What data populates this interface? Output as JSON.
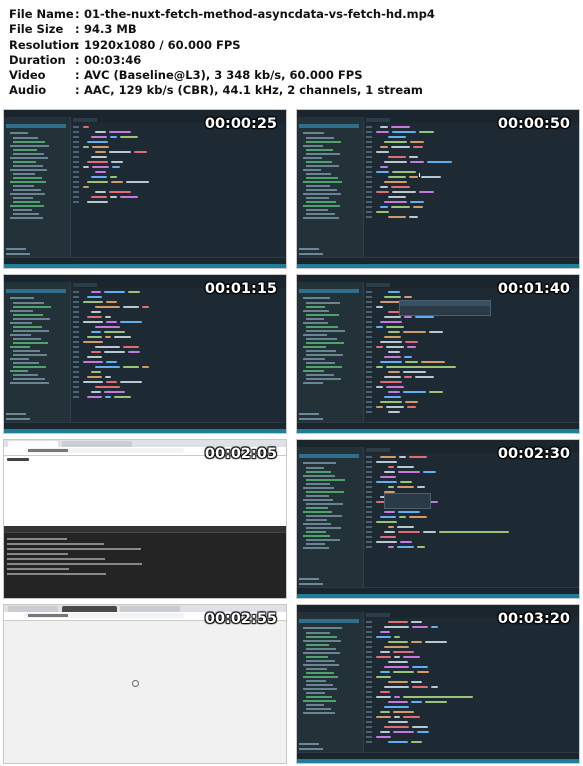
{
  "info": {
    "rows": [
      {
        "key": "File Name",
        "value": "01-the-nuxt-fetch-method-asyncdata-vs-fetch-hd.mp4"
      },
      {
        "key": "File Size",
        "value": "94.3 MB"
      },
      {
        "key": "Resolution",
        "value": "1920x1080 / 60.000 FPS"
      },
      {
        "key": "Duration",
        "value": "00:03:46"
      },
      {
        "key": "Video",
        "value": "AVC (Baseline@L3), 3 348 kb/s, 60.000 FPS"
      },
      {
        "key": "Audio",
        "value": "AAC, 129 kb/s (CBR), 44.1 kHz, 2 channels, 1 stream"
      }
    ],
    "separator": ":"
  },
  "thumbnails": [
    {
      "timestamp": "00:00:25",
      "kind": "editor"
    },
    {
      "timestamp": "00:00:50",
      "kind": "editor"
    },
    {
      "timestamp": "00:01:15",
      "kind": "editor"
    },
    {
      "timestamp": "00:01:40",
      "kind": "editor"
    },
    {
      "timestamp": "00:02:05",
      "kind": "browser-devtools"
    },
    {
      "timestamp": "00:02:30",
      "kind": "editor"
    },
    {
      "timestamp": "00:02:55",
      "kind": "browser-loading"
    },
    {
      "timestamp": "00:03:20",
      "kind": "editor"
    }
  ],
  "colors": {
    "editor_bg": "#1d2a33",
    "sidebar_bg": "#233139",
    "status_bar": "#1e7e97",
    "timestamp_text": "#ffffff"
  }
}
